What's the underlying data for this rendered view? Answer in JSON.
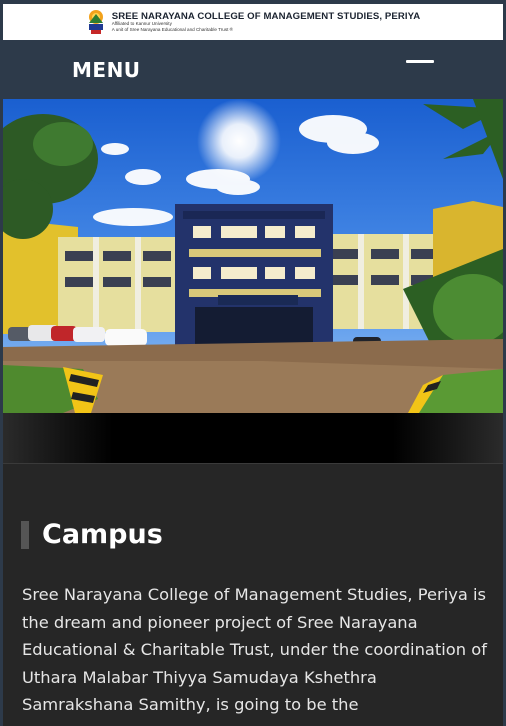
{
  "header": {
    "college_name": "SREE NARAYANA COLLEGE OF MANAGEMENT STUDIES, PERIYA",
    "affiliation": "Affiliated to Kannur University",
    "trust_line": "A unit of Sree Narayana Educational and Charitable Trust ®"
  },
  "nav": {
    "menu_label": "MENU",
    "toggle_icon": "hamburger-icon"
  },
  "hero": {
    "image": "college-campus-building-photo"
  },
  "section": {
    "title": "Campus",
    "paragraph": "Sree Narayana College of Management Studies, Periya is the dream and pioneer project of Sree Narayana Educational & Charitable Trust, under the coordination of Uthara Malabar Thiyya Samudaya Kshethra Samrakshana Samithy, is going to be the"
  },
  "colors": {
    "navbar": "#2d3a4a",
    "content_bg": "#262626",
    "heading_accent": "#555555",
    "text": "#e6e6e6"
  }
}
